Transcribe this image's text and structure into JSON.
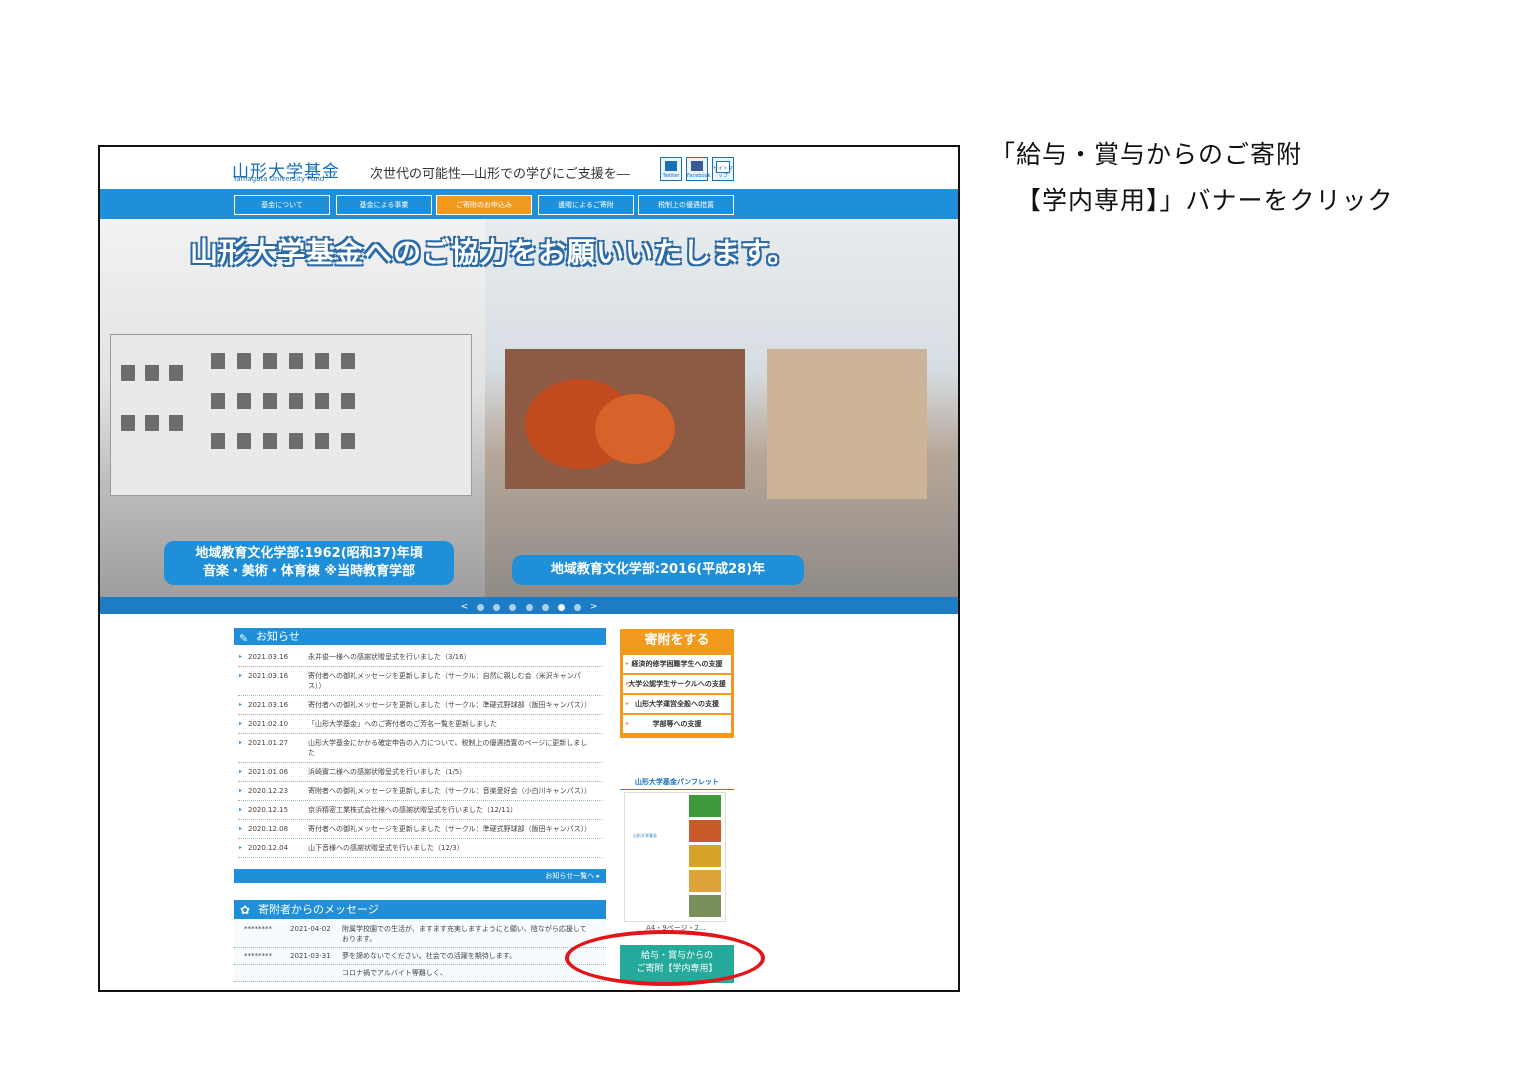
{
  "instruction": {
    "line1": "「給与・賞与からのご寄附",
    "line2": "【学内専用】」バナーをクリック"
  },
  "site": {
    "logo_ja": "山形大学基金",
    "logo_en": "Yamagata University Fund",
    "tagline": "次世代の可能性―山形での学びにご支援を―",
    "header_icons": [
      "Twitter",
      "Facebook",
      "サイトマップ"
    ]
  },
  "nav": {
    "items": [
      {
        "label": "基金について",
        "active": false
      },
      {
        "label": "基金による事業",
        "active": false
      },
      {
        "label": "ご寄附のお申込み",
        "active": true
      },
      {
        "label": "遺贈によるご寄附",
        "active": false
      },
      {
        "label": "税制上の優遇措置",
        "active": false
      }
    ]
  },
  "hero": {
    "title": "山形大学基金へのご協力をお願いいたします。",
    "caption_left_1": "地域教育文化学部:1962(昭和37)年頃",
    "caption_left_2": "音楽・美術・体育棟 ※当時教育学部",
    "caption_right": "地域教育文化学部:2016(平成28)年",
    "prev": "<",
    "next": ">",
    "dots_total": 7,
    "dot_active_index": 5
  },
  "news": {
    "heading": "お知らせ",
    "more": "お知らせ一覧へ ▸",
    "items": [
      {
        "date": "2021.03.16",
        "text": "永井俊一様への感謝状贈呈式を行いました（3/16）"
      },
      {
        "date": "2021.03.16",
        "text": "寄付者への御礼メッセージを更新しました（サークル：自然に親しむ会（米沢キャンパス））"
      },
      {
        "date": "2021.03.16",
        "text": "寄付者への御礼メッセージを更新しました（サークル：準硬式野球部（飯田キャンパス））"
      },
      {
        "date": "2021.02.10",
        "text": "「山形大学基金」へのご寄付者のご芳名一覧を更新しました"
      },
      {
        "date": "2021.01.27",
        "text": "山形大学基金にかかる確定申告の入力について、税制上の優遇措置のページに更新しました"
      },
      {
        "date": "2021.01.06",
        "text": "浜崎實二様への感謝状贈呈式を行いました（1/5）"
      },
      {
        "date": "2020.12.23",
        "text": "寄附者への御礼メッセージを更新しました（サークル：音楽愛好会（小白川キャンパス））"
      },
      {
        "date": "2020.12.15",
        "text": "京浜精密工業株式会社様への感謝状贈呈式を行いました（12/11）"
      },
      {
        "date": "2020.12.08",
        "text": "寄付者への御礼メッセージを更新しました（サークル：準硬式野球部（飯田キャンパス））"
      },
      {
        "date": "2020.12.04",
        "text": "山下音様への感謝状贈呈式を行いました（12/3）"
      }
    ]
  },
  "messages": {
    "heading": "寄附者からのメッセージ",
    "items": [
      {
        "name": "********",
        "date": "2021-04-02",
        "text": "附属学校園での生活が、ますます充実しますようにと願い、陰ながら応援しております。"
      },
      {
        "name": "********",
        "date": "2021-03-31",
        "text": "夢を諦めないでください。社会での活躍を期待します。"
      },
      {
        "name": "",
        "date": "",
        "text": "コロナ禍でアルバイト等難しく、"
      }
    ]
  },
  "donate": {
    "heading": "寄附をする",
    "items": [
      "経済的修学困難学生への支援",
      "大学公認学生サークルへの支援",
      "山形大学運営全般への支援",
      "学部等への支援"
    ]
  },
  "pamphlet": {
    "heading": "山形大学基金パンフレット",
    "caption": "A4・9ページ・2..."
  },
  "kyuyo_banner": {
    "line1": "給与・賞与からの",
    "line2": "ご寄附【学内専用】"
  },
  "colors": {
    "primary": "#1e8fd8",
    "orange": "#f39a1e",
    "teal": "#25a99b",
    "highlight": "#e0161b"
  }
}
